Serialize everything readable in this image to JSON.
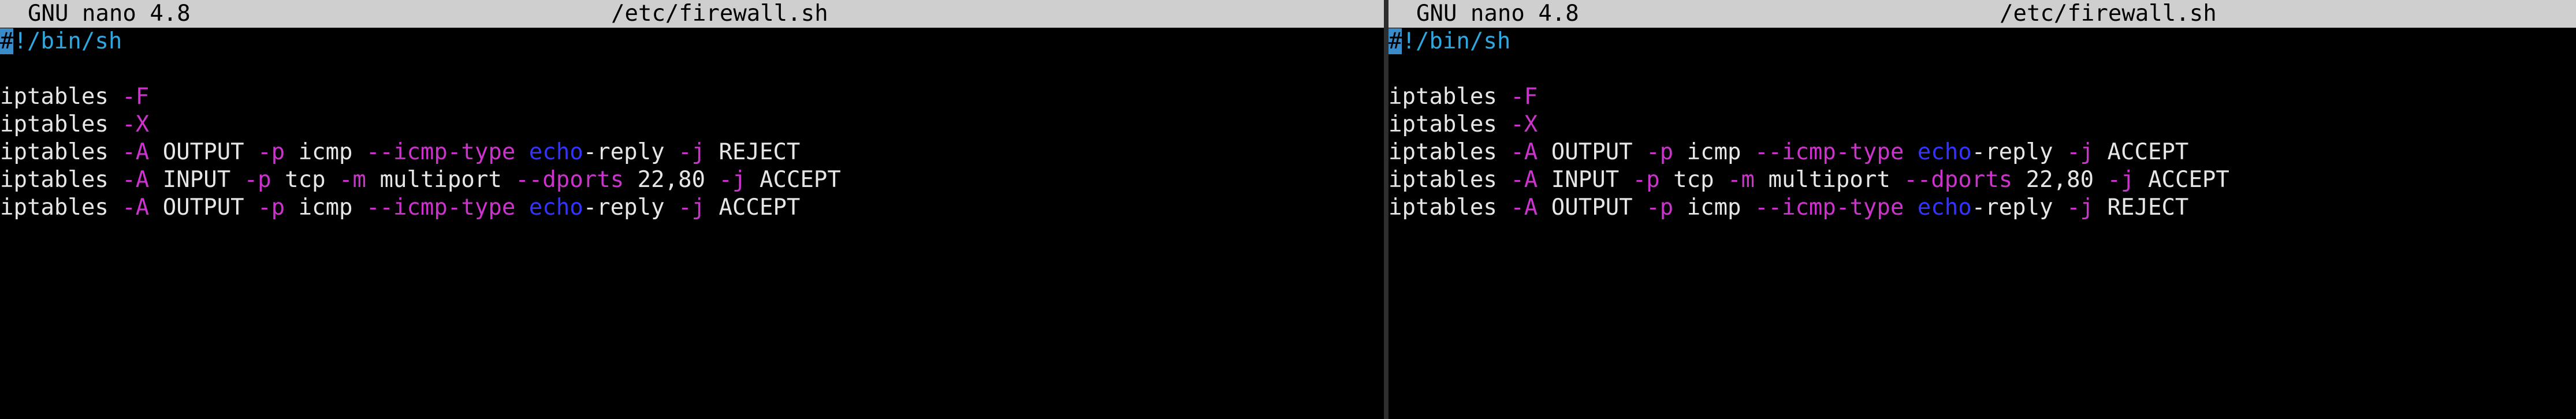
{
  "left_pane": {
    "app_version": "GNU nano 4.8",
    "filename": "/etc/firewall.sh",
    "shebang_cursor": "#",
    "shebang_rest": "!/bin/sh",
    "lines": [
      {
        "cmd": "iptables",
        "parts": [
          "-F"
        ]
      },
      {
        "cmd": "iptables",
        "parts": [
          "-X"
        ]
      },
      {
        "cmd": "iptables",
        "text": "-A OUTPUT -p icmp --icmp-type echo-reply -j REJECT"
      },
      {
        "cmd": "iptables",
        "text": "-A INPUT -p tcp -m multiport --dports 22,80 -j ACCEPT"
      },
      {
        "cmd": "iptables",
        "text": "-A OUTPUT -p icmp --icmp-type echo-reply -j ACCEPT"
      }
    ]
  },
  "right_pane": {
    "app_version": "GNU nano 4.8",
    "filename": "/etc/firewall.sh",
    "shebang_cursor": "#",
    "shebang_rest": "!/bin/sh",
    "lines": [
      {
        "cmd": "iptables",
        "parts": [
          "-F"
        ]
      },
      {
        "cmd": "iptables",
        "parts": [
          "-X"
        ]
      },
      {
        "cmd": "iptables",
        "text": "-A OUTPUT -p icmp --icmp-type echo-reply -j ACCEPT"
      },
      {
        "cmd": "iptables",
        "text": "-A INPUT -p tcp -m multiport --dports 22,80 -j ACCEPT"
      },
      {
        "cmd": "iptables",
        "text": "-A OUTPUT -p icmp --icmp-type echo-reply -j REJECT"
      }
    ]
  },
  "tokens": {
    "iptables": "iptables",
    "F": "-F",
    "X": "-X",
    "A": "-A",
    "OUTPUT": "OUTPUT",
    "INPUT": "INPUT",
    "p": "-p",
    "icmp": "icmp",
    "tcp": "tcp",
    "icmp_type": "--icmp-type",
    "echo": "echo",
    "reply": "-reply",
    "j": "-j",
    "REJECT": "REJECT",
    "ACCEPT": "ACCEPT",
    "m": "-m",
    "multiport": "multiport",
    "dports": "--dports",
    "ports": "22,80"
  },
  "colors": {
    "titlebar_bg": "#cfcfcf",
    "flag": "#cc33cc",
    "keyword": "#3333ff",
    "shebang": "#2fa8e0",
    "cursor": "#3a8cc8",
    "text": "#e6e6e6"
  }
}
